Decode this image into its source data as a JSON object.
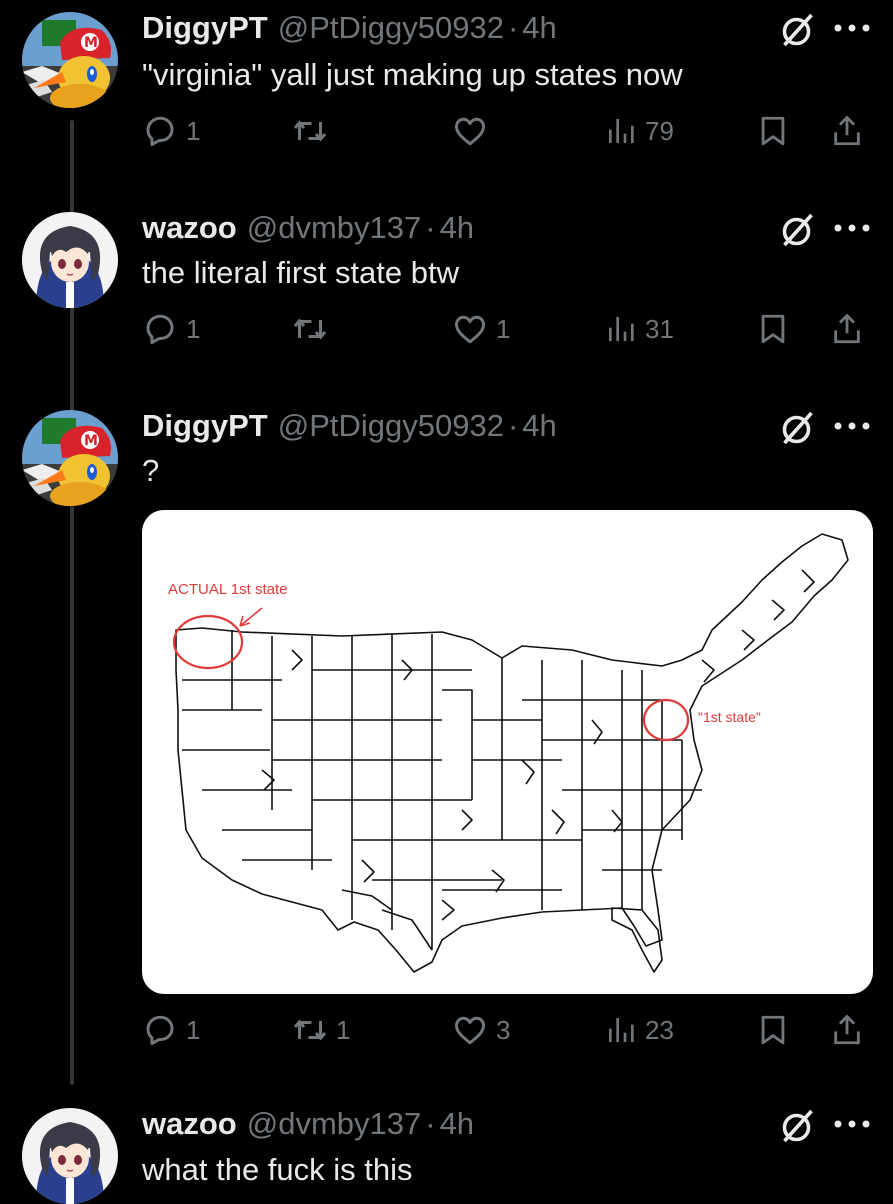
{
  "tweets": [
    {
      "name": "DiggyPT",
      "handle": "@PtDiggy50932",
      "dot": "·",
      "time": "4h",
      "text": "\"virginia\" yall just making up states now",
      "replies": "1",
      "reposts": "",
      "likes": "",
      "views": "79",
      "avatar": "mario-avatar"
    },
    {
      "name": "wazoo",
      "handle": "@dvmby137",
      "dot": "·",
      "time": "4h",
      "text": "the literal first state btw",
      "replies": "1",
      "reposts": "",
      "likes": "1",
      "views": "31",
      "avatar": "anime-avatar"
    },
    {
      "name": "DiggyPT",
      "handle": "@PtDiggy50932",
      "dot": "·",
      "time": "4h",
      "text": "?",
      "replies": "1",
      "reposts": "1",
      "likes": "3",
      "views": "23",
      "avatar": "mario-avatar",
      "media": {
        "annotation_left": "ACTUAL 1st state",
        "annotation_right": "\"1st state\"",
        "accent": "#e03a3a"
      }
    },
    {
      "name": "wazoo",
      "handle": "@dvmby137",
      "dot": "·",
      "time": "4h",
      "text": "what the fuck is this",
      "avatar": "anime-avatar"
    }
  ],
  "colors": {
    "background": "#000000",
    "muted": "#71767b",
    "text": "#e7e9ea",
    "thread_line": "#333639"
  }
}
